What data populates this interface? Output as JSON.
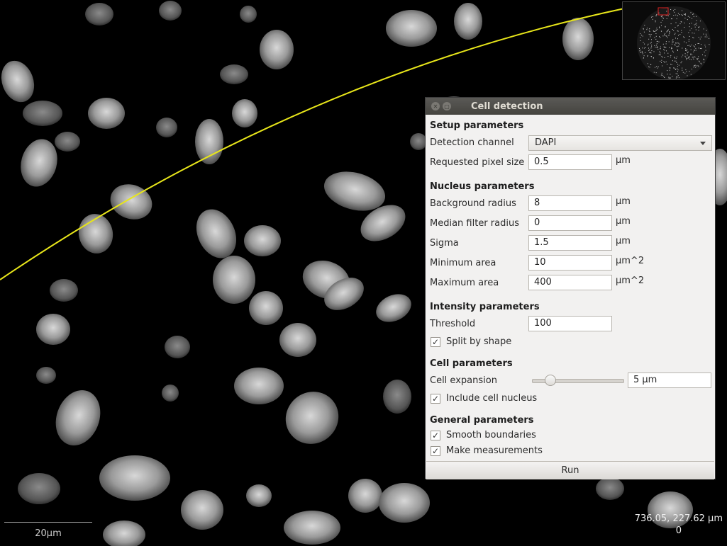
{
  "viewer": {
    "scale_label": "20µm",
    "coords_line1": "736.05, 227.62 µm",
    "coords_line2": "0",
    "annotation_color": "#e8e61a"
  },
  "dialog": {
    "title": "Cell detection",
    "setup": {
      "heading": "Setup parameters",
      "detection_channel_label": "Detection channel",
      "detection_channel_value": "DAPI",
      "pixel_size_label": "Requested pixel size",
      "pixel_size_value": "0.5",
      "pixel_size_unit": "µm"
    },
    "nucleus": {
      "heading": "Nucleus parameters",
      "background_radius_label": "Background radius",
      "background_radius_value": "8",
      "background_radius_unit": "µm",
      "median_filter_label": "Median filter radius",
      "median_filter_value": "0",
      "median_filter_unit": "µm",
      "sigma_label": "Sigma",
      "sigma_value": "1.5",
      "sigma_unit": "µm",
      "min_area_label": "Minimum area",
      "min_area_value": "10",
      "min_area_unit": "µm^2",
      "max_area_label": "Maximum area",
      "max_area_value": "400",
      "max_area_unit": "µm^2"
    },
    "intensity": {
      "heading": "Intensity parameters",
      "threshold_label": "Threshold",
      "threshold_value": "100",
      "split_label": "Split by shape",
      "split_checked": true
    },
    "cell": {
      "heading": "Cell parameters",
      "expansion_label": "Cell expansion",
      "expansion_value": "5 µm",
      "expansion_slider_fraction": 0.15,
      "include_nucleus_label": "Include cell nucleus",
      "include_nucleus_checked": true
    },
    "general": {
      "heading": "General parameters",
      "smooth_label": "Smooth boundaries",
      "smooth_checked": true,
      "measure_label": "Make measurements",
      "measure_checked": true
    },
    "run_label": "Run"
  }
}
